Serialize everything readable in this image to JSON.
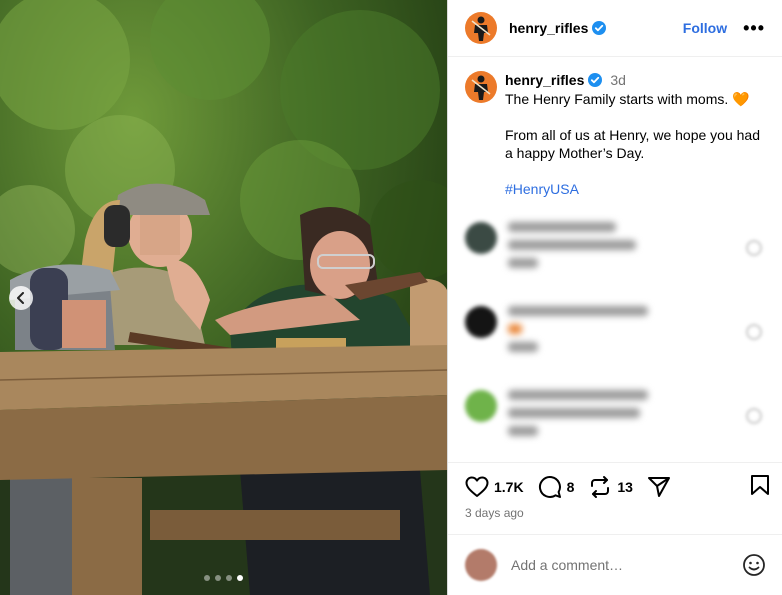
{
  "post": {
    "username": "henry_rifles",
    "follow_label": "Follow",
    "more_label": "•••",
    "time": "3d",
    "caption_line1": "The Henry Family starts with moms. 🧡",
    "caption_line2": "From all of us at Henry, we hope you had a happy Mother’s Day.",
    "hashtag": "#HenryUSA",
    "likes": "1.7K",
    "comments": "8",
    "reposts": "13",
    "posted": "3 days ago",
    "carousel": {
      "count": 4,
      "active_index": 3
    }
  },
  "comments": [
    {
      "avatar_color": "#3b4a44",
      "lines": [
        70,
        82,
        128,
        30
      ]
    },
    {
      "avatar_color": "#141414",
      "lines": [
        120,
        12,
        30
      ]
    },
    {
      "avatar_color": "#6fb34a",
      "lines": [
        108,
        132,
        30
      ]
    }
  ],
  "comment_box": {
    "placeholder": "Add a comment…"
  },
  "colors": {
    "accent": "#2e6ee0",
    "avatar": "#ec7a2a"
  }
}
